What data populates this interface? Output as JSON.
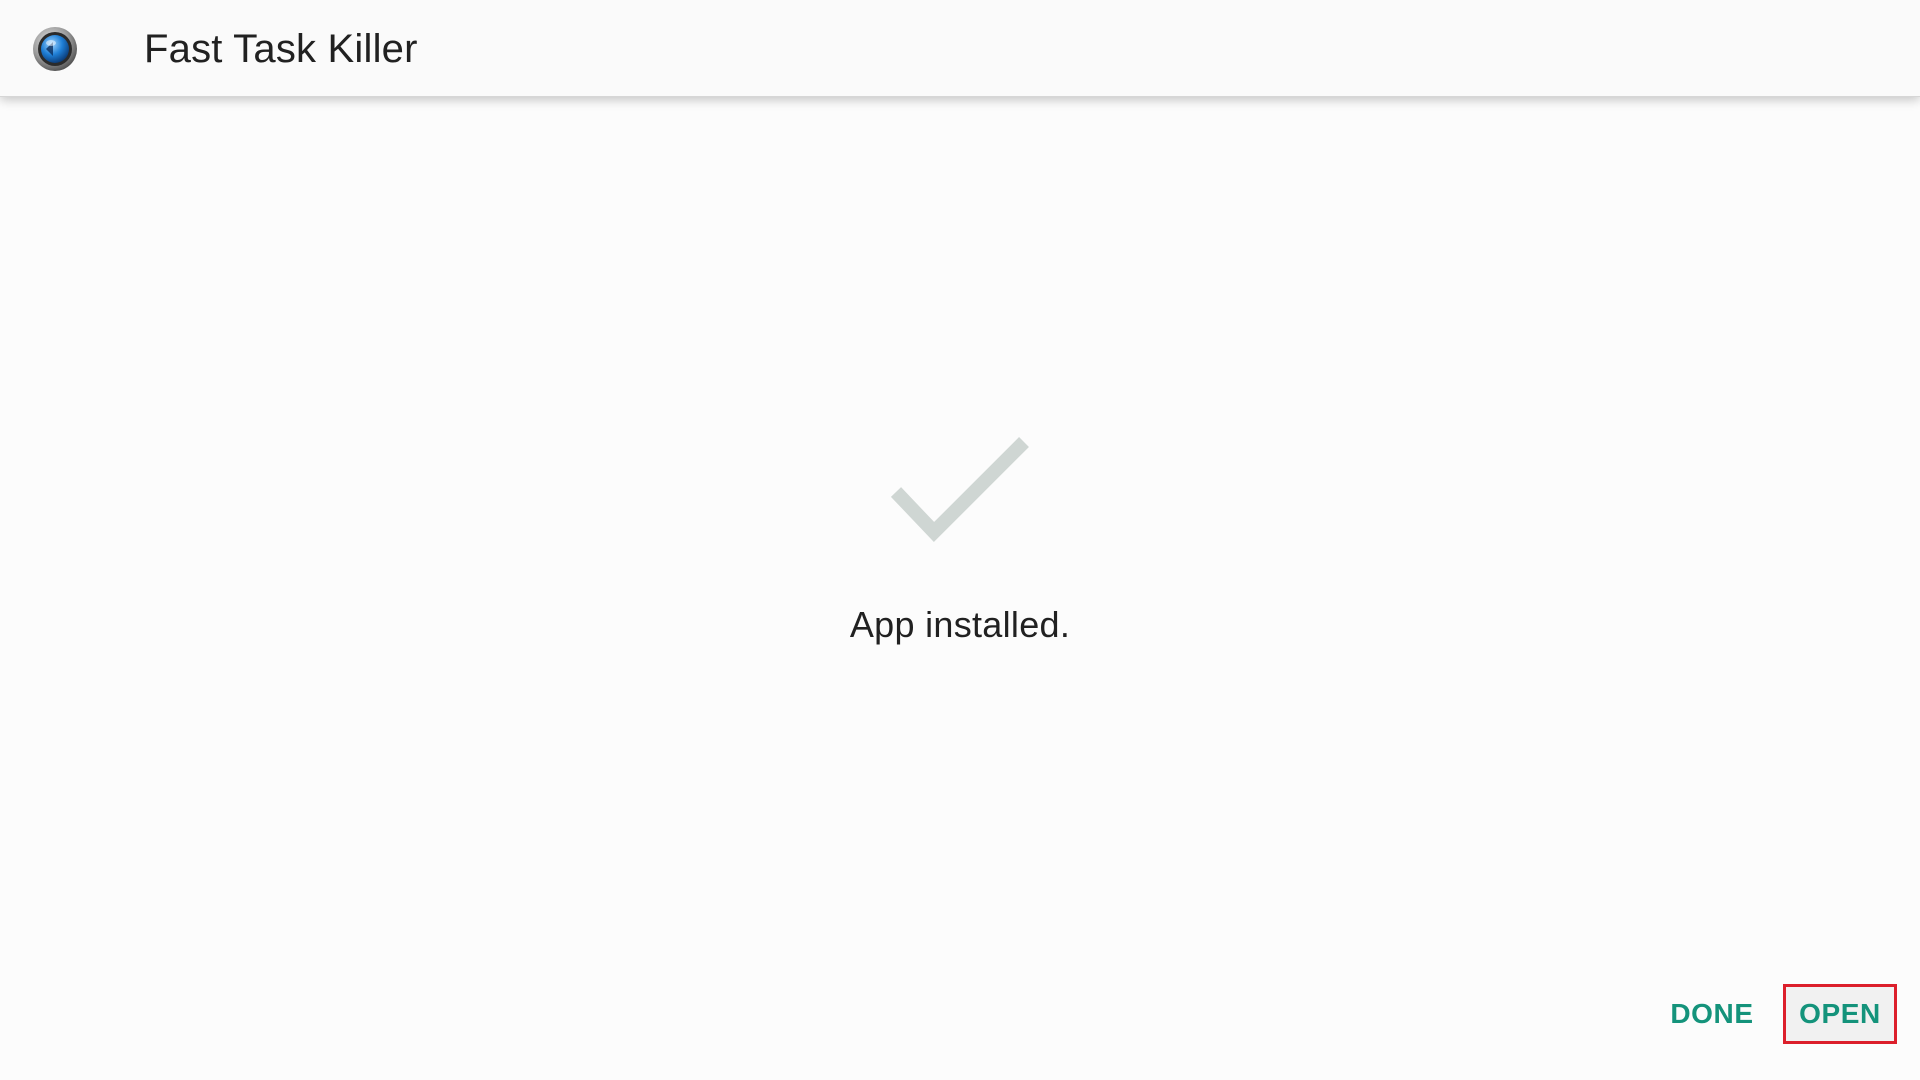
{
  "app": {
    "title": "Fast Task Killer",
    "icon": "app-launcher-icon"
  },
  "main": {
    "status_icon": "checkmark-icon",
    "status_message": "App installed."
  },
  "actions": {
    "done_label": "DONE",
    "open_label": "OPEN"
  },
  "colors": {
    "accent": "#14937b",
    "checkmark": "#cfd6d3",
    "highlight_border": "#dc1f2b",
    "app_bar": "#fafafa",
    "background": "#fcfcfc"
  }
}
